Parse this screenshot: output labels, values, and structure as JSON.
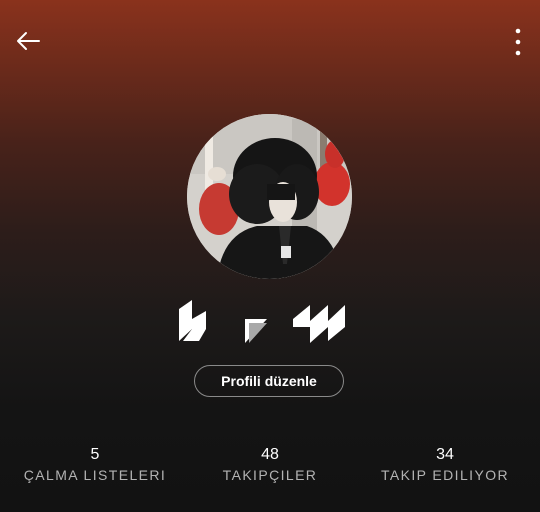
{
  "header": {
    "back_icon": "arrow-left-icon",
    "more_icon": "more-vertical-icon"
  },
  "profile": {
    "avatar_icon": "profile-photo",
    "display_name_icon": "stylized-name-graphic",
    "edit_label": "Profili düzenle"
  },
  "stats": [
    {
      "value": "5",
      "label": "ÇALMA LISTELERI"
    },
    {
      "value": "48",
      "label": "TAKIPÇILER"
    },
    {
      "value": "34",
      "label": "TAKIP EDILIYOR"
    }
  ],
  "colors": {
    "gradient_top": "#8a321c",
    "background": "#121212",
    "muted_text": "#b3b3b3"
  }
}
